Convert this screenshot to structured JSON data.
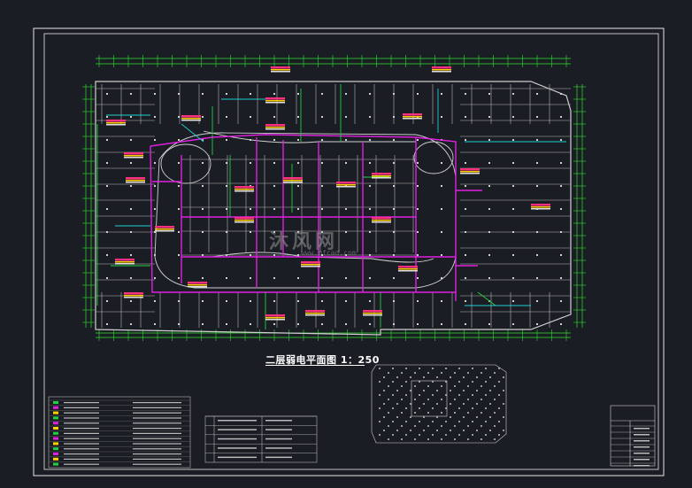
{
  "drawing": {
    "title": "二层弱电平面图 1：250",
    "watermark_text": "沐风网",
    "watermark_url": "www.mfcad.com"
  },
  "colors": {
    "background": "#1a1d23",
    "frame": "#e8e8e8",
    "walls": "#cfcfcf",
    "magenta_cable": "#e020e0",
    "green_cable": "#20d040",
    "cyan_cable": "#20d0d0",
    "grid_axis": "#30e030",
    "label_tag": "#ff3080"
  }
}
